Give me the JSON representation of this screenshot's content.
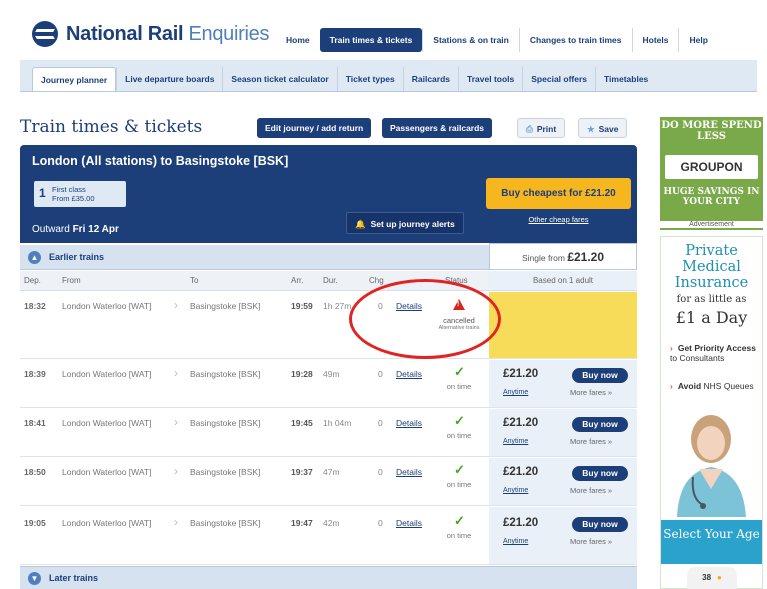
{
  "header": {
    "logo_bold": "National Rail",
    "logo_light": "Enquiries",
    "nav": [
      "Home",
      "Train times & tickets",
      "Stations & on train",
      "Changes to train times",
      "Hotels",
      "Help"
    ],
    "nav_active_index": 1
  },
  "subnav": {
    "items": [
      "Journey planner",
      "Live departure boards",
      "Season ticket calculator",
      "Ticket types",
      "Railcards",
      "Travel tools",
      "Special offers",
      "Timetables"
    ],
    "active_index": 0
  },
  "page": {
    "title": "Train times & tickets",
    "edit_journey": "Edit journey / add return",
    "passengers": "Passengers & railcards",
    "print": "Print",
    "save": "Save"
  },
  "journey": {
    "route": "London (All stations) to Basingstoke [BSK]",
    "first_class_num": "1",
    "first_class_label": "First class",
    "first_class_price": "From £35.00",
    "outward_label": "Outward",
    "outward_date": "Fri 12 Apr",
    "alerts": "Set up journey alerts",
    "buy_cheapest": "Buy cheapest for £21.20",
    "other_fares": "Other cheap fares",
    "single_from_label": "Single from",
    "single_from_price": "£21.20",
    "earlier": "Earlier trains",
    "later": "Later trains"
  },
  "table": {
    "headers": {
      "dep": "Dep.",
      "from": "From",
      "to": "To",
      "arr": "Arr.",
      "dur": "Dur.",
      "chg": "Chg",
      "status": "Status",
      "based_on": "Based on 1 adult"
    },
    "rows": [
      {
        "dep": "18:32",
        "from": "London Waterloo [WAT]",
        "to": "Basingstoke [BSK]",
        "arr": "19:59",
        "dur": "1h 27m",
        "chg": "0",
        "details": "Details",
        "status": "cancelled",
        "alt": "Alternative trains"
      },
      {
        "dep": "18:39",
        "from": "London Waterloo [WAT]",
        "to": "Basingstoke [BSK]",
        "arr": "19:28",
        "dur": "49m",
        "chg": "0",
        "details": "Details",
        "status": "on time",
        "price": "£21.20",
        "fare_type": "Anytime",
        "buy": "Buy now",
        "more": "More fares »"
      },
      {
        "dep": "18:41",
        "from": "London Waterloo [WAT]",
        "to": "Basingstoke [BSK]",
        "arr": "19:45",
        "dur": "1h 04m",
        "chg": "0",
        "details": "Details",
        "status": "on time",
        "price": "£21.20",
        "fare_type": "Anytime",
        "buy": "Buy now",
        "more": "More fares »"
      },
      {
        "dep": "18:50",
        "from": "London Waterloo [WAT]",
        "to": "Basingstoke [BSK]",
        "arr": "19:37",
        "dur": "47m",
        "chg": "0",
        "details": "Details",
        "status": "on time",
        "price": "£21.20",
        "fare_type": "Anytime",
        "buy": "Buy now",
        "more": "More fares »"
      },
      {
        "dep": "19:05",
        "from": "London Waterloo [WAT]",
        "to": "Basingstoke [BSK]",
        "arr": "19:47",
        "dur": "42m",
        "chg": "0",
        "details": "Details",
        "status": "on time",
        "price": "£21.20",
        "fare_type": "Anytime",
        "buy": "Buy now",
        "more": "More fares »"
      }
    ]
  },
  "ads": {
    "groupon_top": "DO MORE SPEND LESS",
    "groupon_logo": "GROUPON",
    "groupon_bottom": "HUGE SAVINGS IN YOUR CITY",
    "advertisement": "Advertisement",
    "pmi_1": "Private",
    "pmi_2": "Medical",
    "pmi_3": "Insurance",
    "pmi_4": "for as little as",
    "pmi_5": "£1 a Day",
    "bullet1_bold": "Get Priority Access",
    "bullet1_rest": "to Consultants",
    "bullet2_bold": "Avoid",
    "bullet2_rest": "NHS Queues",
    "select_age": "Select Your Age",
    "age_value": "38"
  },
  "colors": {
    "brand_blue": "#1c3f7a",
    "cancelled_yellow": "#f6dc59",
    "buy_orange": "#f5b61e",
    "annotation_red": "#e02323",
    "on_time_green": "#4aa12a"
  }
}
